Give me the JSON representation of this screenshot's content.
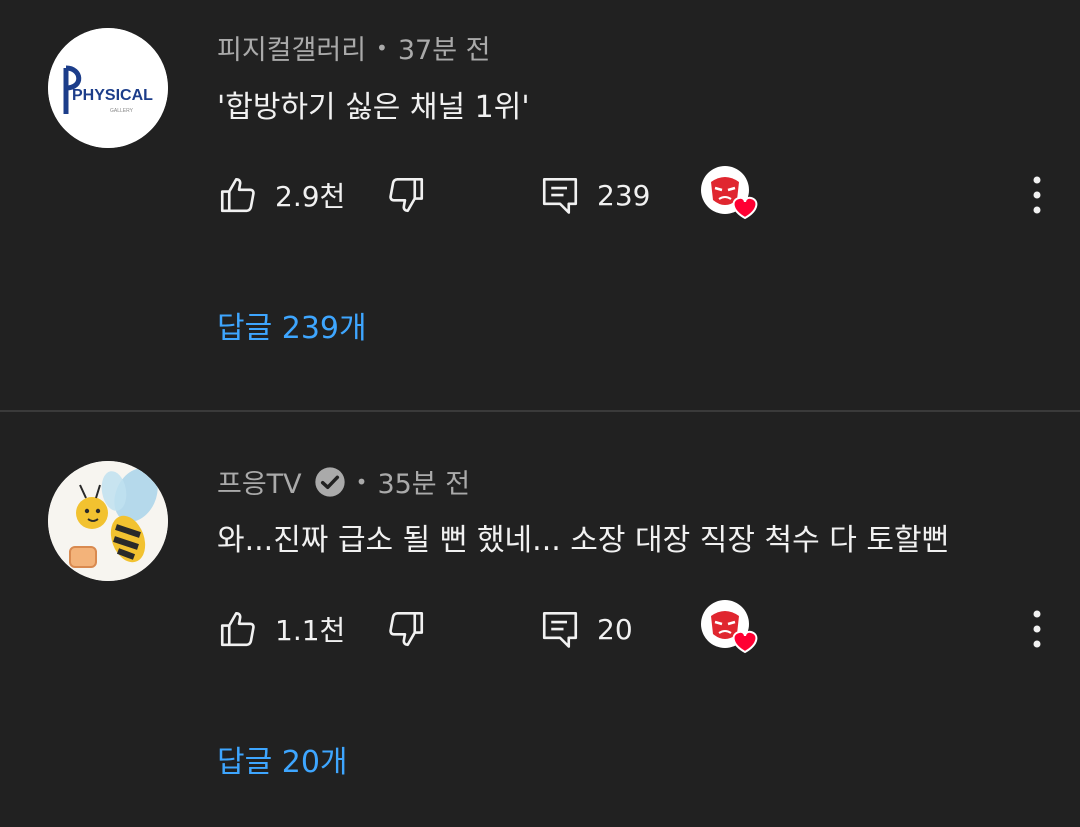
{
  "comments": [
    {
      "author": "피지컬갤러리",
      "separator": "•",
      "time": "37분 전",
      "text": "'합방하기 싫은 채널 1위'",
      "likes": "2.9천",
      "reply_count": "239",
      "replies_link": "답글 239개",
      "verified": false,
      "avatar_text": "PHYSICAL",
      "avatar_subtext": "GALLERY"
    },
    {
      "author": "프응TV",
      "separator": "•",
      "time": "35분 전",
      "text": "와...진짜 급소 될 뻔 했네... 소장 대장 직장 척수 다 토할뻔",
      "likes": "1.1천",
      "reply_count": "20",
      "replies_link": "답글 20개",
      "verified": true
    }
  ],
  "colors": {
    "background": "#212121",
    "link": "#3ea6ff",
    "meta": "#aaaaaa",
    "heart": "#ff0033"
  },
  "icons": [
    "like-icon",
    "dislike-icon",
    "reply-icon",
    "creator-heart-icon",
    "more-options-icon",
    "verified-badge-icon"
  ]
}
